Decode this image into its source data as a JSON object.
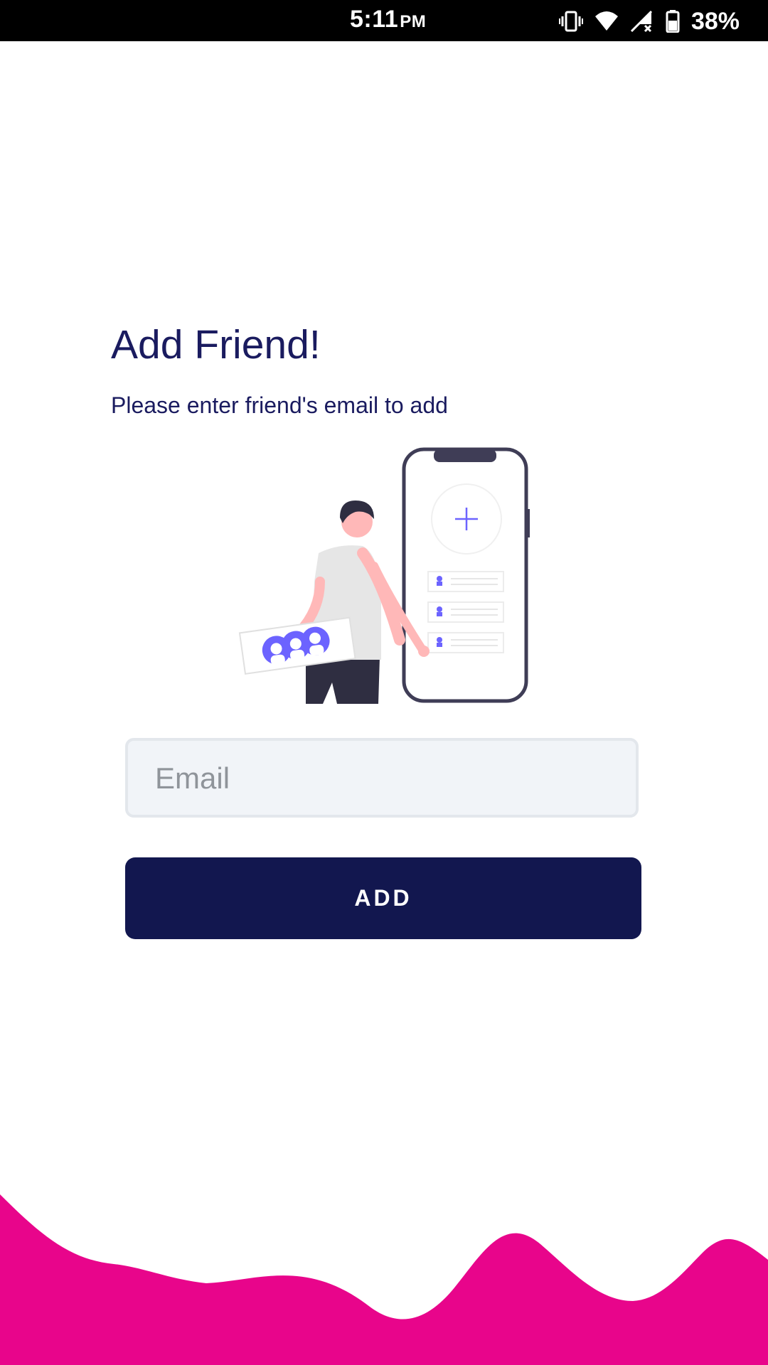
{
  "status_bar": {
    "time": "5:11",
    "ampm": "PM",
    "battery_percent": "38%",
    "icons": [
      "vibrate-icon",
      "wifi-icon",
      "signal-icon",
      "battery-icon"
    ]
  },
  "screen": {
    "title": "Add Friend!",
    "subtitle": "Please enter friend's email to add"
  },
  "form": {
    "email_placeholder": "Email",
    "email_value": "",
    "add_label": "ADD"
  },
  "colors": {
    "primary": "#12174f",
    "title_text": "#1a1b5f",
    "wave": "#e8058b",
    "accent_illustration": "#6c63ff"
  }
}
